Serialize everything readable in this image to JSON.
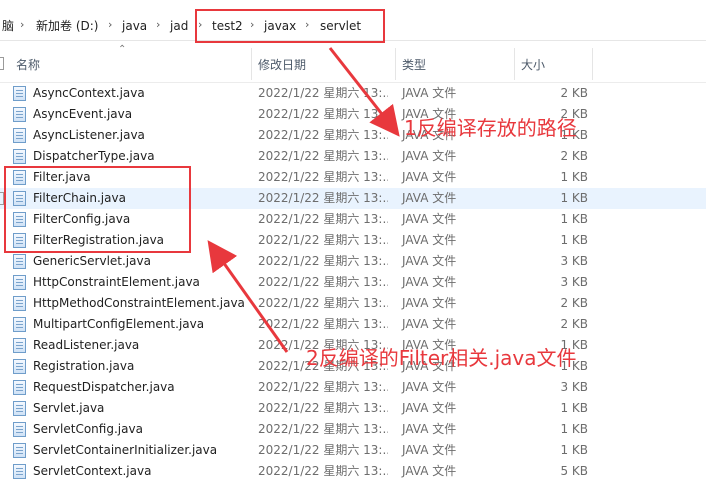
{
  "breadcrumb": {
    "items": [
      "脑",
      "新加卷 (D:)",
      "java",
      "jad",
      "test2",
      "javax",
      "servlet"
    ],
    "separator": "›"
  },
  "columns": {
    "name": "名称",
    "date": "修改日期",
    "type": "类型",
    "size": "大小"
  },
  "files": [
    {
      "name": "AsyncContext.java",
      "date": "2022/1/22 星期六 13:...",
      "type": "JAVA 文件",
      "size": "2 KB"
    },
    {
      "name": "AsyncEvent.java",
      "date": "2022/1/22 星期六 13:...",
      "type": "JAVA 文件",
      "size": "2 KB"
    },
    {
      "name": "AsyncListener.java",
      "date": "2022/1/22 星期六 13:...",
      "type": "JAVA 文件",
      "size": "1 KB"
    },
    {
      "name": "DispatcherType.java",
      "date": "2022/1/22 星期六 13:...",
      "type": "JAVA 文件",
      "size": "2 KB"
    },
    {
      "name": "Filter.java",
      "date": "2022/1/22 星期六 13:...",
      "type": "JAVA 文件",
      "size": "1 KB"
    },
    {
      "name": "FilterChain.java",
      "date": "2022/1/22 星期六 13:...",
      "type": "JAVA 文件",
      "size": "1 KB"
    },
    {
      "name": "FilterConfig.java",
      "date": "2022/1/22 星期六 13:...",
      "type": "JAVA 文件",
      "size": "1 KB"
    },
    {
      "name": "FilterRegistration.java",
      "date": "2022/1/22 星期六 13:...",
      "type": "JAVA 文件",
      "size": "1 KB"
    },
    {
      "name": "GenericServlet.java",
      "date": "2022/1/22 星期六 13:...",
      "type": "JAVA 文件",
      "size": "3 KB"
    },
    {
      "name": "HttpConstraintElement.java",
      "date": "2022/1/22 星期六 13:...",
      "type": "JAVA 文件",
      "size": "3 KB"
    },
    {
      "name": "HttpMethodConstraintElement.java",
      "date": "2022/1/22 星期六 13:...",
      "type": "JAVA 文件",
      "size": "2 KB"
    },
    {
      "name": "MultipartConfigElement.java",
      "date": "2022/1/22 星期六 13:...",
      "type": "JAVA 文件",
      "size": "2 KB"
    },
    {
      "name": "ReadListener.java",
      "date": "2022/1/22 星期六 13:...",
      "type": "JAVA 文件",
      "size": "1 KB"
    },
    {
      "name": "Registration.java",
      "date": "2022/1/22 星期六 13:...",
      "type": "JAVA 文件",
      "size": "1 KB"
    },
    {
      "name": "RequestDispatcher.java",
      "date": "2022/1/22 星期六 13:...",
      "type": "JAVA 文件",
      "size": "3 KB"
    },
    {
      "name": "Servlet.java",
      "date": "2022/1/22 星期六 13:...",
      "type": "JAVA 文件",
      "size": "1 KB"
    },
    {
      "name": "ServletConfig.java",
      "date": "2022/1/22 星期六 13:...",
      "type": "JAVA 文件",
      "size": "1 KB"
    },
    {
      "name": "ServletContainerInitializer.java",
      "date": "2022/1/22 星期六 13:...",
      "type": "JAVA 文件",
      "size": "1 KB"
    },
    {
      "name": "ServletContext.java",
      "date": "2022/1/22 星期六 13:...",
      "type": "JAVA 文件",
      "size": "5 KB"
    }
  ],
  "selected_row": "FilterChain.java",
  "annotations": {
    "note1": "1反编译存放的路径",
    "note2": "2反编译的Filter相关.java文件",
    "color": "#e8383d"
  },
  "colors": {
    "selection": "#e9f3fe",
    "header_text": "#4d5a6a",
    "secondary_text": "#6d6d6d"
  },
  "icons": {
    "file": "java-file-icon",
    "sort": "sort-caret-icon",
    "separator": "chevron-right-icon"
  }
}
